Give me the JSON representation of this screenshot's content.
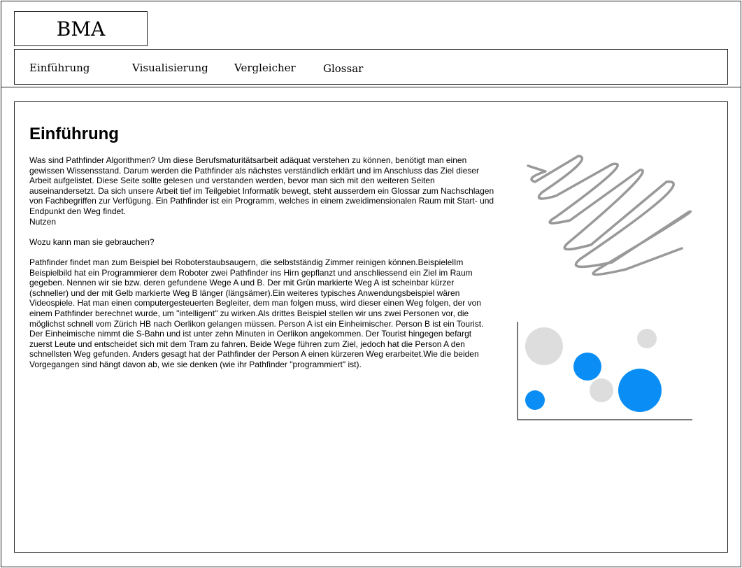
{
  "header": {
    "logo": "BMA"
  },
  "nav": {
    "items": [
      {
        "label": "Einführung"
      },
      {
        "label": "Visualisierung"
      },
      {
        "label": "Vergleicher"
      },
      {
        "label": "Glossar"
      }
    ]
  },
  "main": {
    "title": "Einführung",
    "intro": " Was sind Pathfinder Algorithmen? Um diese Berufsmaturitätsarbeit adäquat verstehen zu können, benötigt man einen gewissen Wissensstand. Darum werden die Pathfinder als nächstes verständlich erklärt und im Anschluss das Ziel dieser Arbeit aufgelistet. Diese Seite sollte gelesen und verstanden werden, bevor man sich mit den weiteren Seiten auseinandersetzt. Da sich unsere Arbeit tief im Teilgebiet Informatik bewegt, steht ausserdem ein Glossar zum Nachschlagen von Fachbegriffen zur Verfügung. Ein Pathfinder ist ein Programm, welches in einem zweidimensionalen Raum mit Start- und Endpunkt den Weg findet.",
    "subheading": "Nutzen",
    "question": "Wozu kann man sie gebrauchen?",
    "body": "Pathfinder findet man zum Beispiel bei Roboterstaubsaugern, die selbstständig Zimmer reinigen können.BeispielelIm Beispielbild hat ein Programmierer dem Roboter zwei Pathfinder ins Hirn gepflanzt und anschliessend ein Ziel im Raum gegeben. Nennen wir sie bzw. deren gefundene Wege A und B. Der mit Grün markierte Weg A ist scheinbar kürzer (schneller) und der mit Gelb markierte Weg B länger (längsämer).Ein weiteres typisches Anwendungsbeispiel wären Videospiele. Hat man einen computergesteuerten Begleiter, dem man folgen muss, wird dieser einen Weg folgen, der von einem Pathfinder berechnet wurde, um \"intelligent\" zu wirken.Als drittes Beispiel stellen wir uns zwei Personen vor, die möglichst schnell vom Zürich HB nach Oerlikon gelangen müssen. Person A ist ein Einheimischer. Person B ist ein Tourist. Der Einheimische nimmt die S-Bahn und ist unter zehn Minuten in Oerlikon angekommen. Der Tourist hingegen befargt zuerst Leute und entscheidet sich mit dem Tram zu fahren. Beide Wege führen zum Ziel, jedoch hat die Person A den schnellsten Weg gefunden. Anders gesagt hat der Pathfinder der Person A einen kürzeren Weg erarbeitet.Wie die beiden Vorgegangen sind hängt davon ab, wie sie denken (wie ihr Pathfinder \"programmiert\" ist)."
  },
  "images": {
    "scribble_icon": "image-placeholder-scribble",
    "chart_icon": "bubble-chart-placeholder"
  },
  "colors": {
    "accent_blue": "#0a8ef5",
    "placeholder_gray": "#dddddd",
    "scribble_gray": "#999999"
  }
}
